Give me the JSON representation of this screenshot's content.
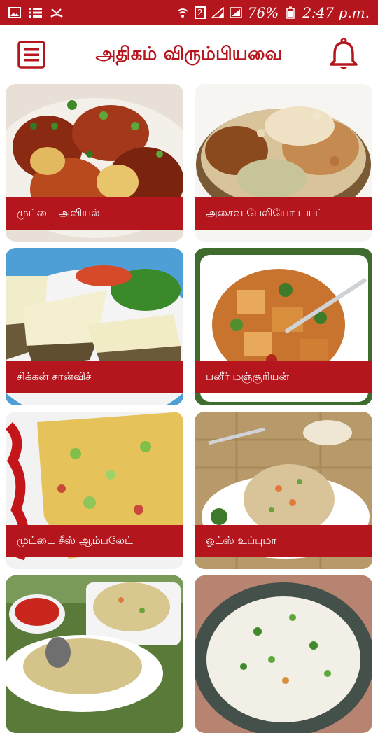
{
  "status_bar": {
    "battery_percent": "76%",
    "time": "2:47 p.m.",
    "sim_label": "2"
  },
  "app_bar": {
    "title": "அதிகம் விரும்பியவை"
  },
  "recipes": [
    {
      "label": "முட்டை அவியல்"
    },
    {
      "label": "அசைவ பேலியோ டயட்"
    },
    {
      "label": "சிக்கன் சான்விச்"
    },
    {
      "label": "பனீர் மஞ்சூரியன்"
    },
    {
      "label": "முட்டை சீஸ் ஆம்பலேட்"
    },
    {
      "label": "ஓட்ஸ் உப்புமா"
    },
    {
      "label": ""
    },
    {
      "label": ""
    }
  ],
  "colors": {
    "brand": "#b5151d"
  }
}
